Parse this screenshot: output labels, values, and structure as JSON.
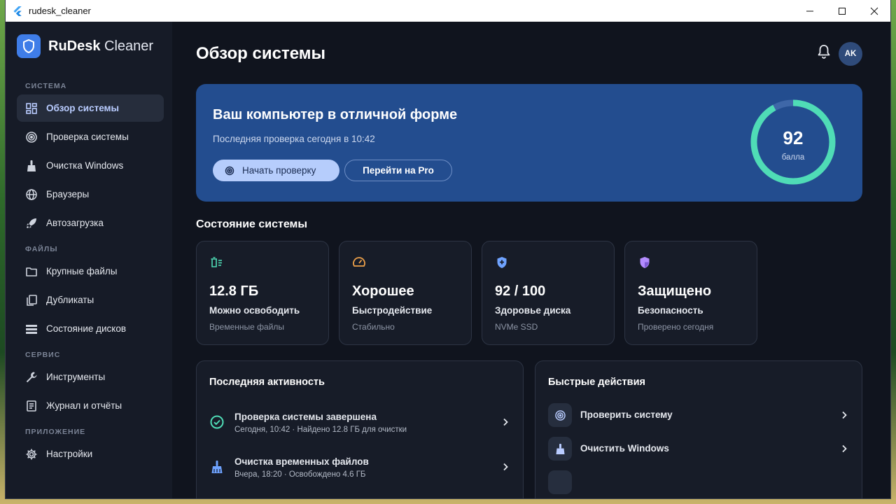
{
  "window": {
    "title": "rudesk_cleaner",
    "controls": [
      "minimize-icon",
      "maximize-icon",
      "close-icon"
    ]
  },
  "brand": {
    "name_bold": "RuDesk",
    "name_light": "Cleaner",
    "logo_icon": "shield-icon",
    "accent": "#3f7de8"
  },
  "sidebar": {
    "sections": [
      {
        "label": "СИСТЕМА",
        "items": [
          {
            "label": "Обзор системы",
            "icon": "dashboard-icon",
            "active": true
          },
          {
            "label": "Проверка системы",
            "icon": "scan-icon"
          },
          {
            "label": "Очистка Windows",
            "icon": "broom-icon"
          },
          {
            "label": "Браузеры",
            "icon": "globe-icon"
          },
          {
            "label": "Автозагрузка",
            "icon": "rocket-icon"
          }
        ]
      },
      {
        "label": "ФАЙЛЫ",
        "items": [
          {
            "label": "Крупные файлы",
            "icon": "folder-icon"
          },
          {
            "label": "Дубликаты",
            "icon": "duplicate-icon"
          },
          {
            "label": "Состояние дисков",
            "icon": "storage-icon"
          }
        ]
      },
      {
        "label": "СЕРВИС",
        "items": [
          {
            "label": "Инструменты",
            "icon": "wrench-icon"
          },
          {
            "label": "Журнал и отчёты",
            "icon": "report-icon"
          }
        ]
      },
      {
        "label": "ПРИЛОЖЕНИЕ",
        "items": [
          {
            "label": "Настройки",
            "icon": "gear-icon"
          }
        ]
      }
    ]
  },
  "header": {
    "title": "Обзор системы",
    "notification_icon": "bell-icon",
    "avatar_initials": "AK"
  },
  "hero": {
    "title": "Ваш компьютер в отличной форме",
    "subtitle": "Последняя проверка сегодня в 10:42",
    "primary_button": "Начать проверку",
    "secondary_button": "Перейти на Pro",
    "score": "92",
    "score_unit": "балла",
    "score_fraction": 0.92,
    "background": "#234d8f",
    "ring_color": "#4fdcb6"
  },
  "status": {
    "title": "Состояние системы",
    "cards": [
      {
        "value": "12.8 ГБ",
        "label": "Можно освободить",
        "sub": "Временные файлы",
        "icon": "trash-list-icon",
        "color": "#4fdcb6"
      },
      {
        "value": "Хорошее",
        "label": "Быстродействие",
        "sub": "Стабильно",
        "icon": "speedometer-icon",
        "color": "#f0a24a"
      },
      {
        "value": "92 / 100",
        "label": "Здоровье диска",
        "sub": "NVMe SSD",
        "icon": "shield-plus-icon",
        "color": "#6fa3ff"
      },
      {
        "value": "Защищено",
        "label": "Безопасность",
        "sub": "Проверено сегодня",
        "icon": "security-shield-icon",
        "color": "#b48cff"
      }
    ]
  },
  "activity": {
    "title": "Последняя активность",
    "items": [
      {
        "title": "Проверка системы завершена",
        "sub": "Сегодня, 10:42 · Найдено 12.8 ГБ для очистки",
        "icon": "check-circle-icon"
      },
      {
        "title": "Очистка временных файлов",
        "sub": "Вчера, 18:20 · Освобождено 4.6 ГБ",
        "icon": "broom-icon"
      }
    ]
  },
  "quick_actions": {
    "title": "Быстрые действия",
    "items": [
      {
        "label": "Проверить систему",
        "icon": "scan-icon"
      },
      {
        "label": "Очистить Windows",
        "icon": "broom-icon"
      }
    ]
  }
}
